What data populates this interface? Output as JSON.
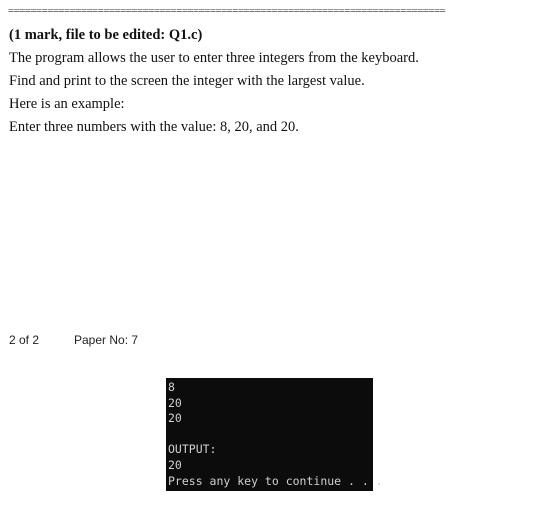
{
  "separator": "==============================================================================",
  "heading": "(1 mark, file to be edited: Q1.c)",
  "lines": [
    "The program allows the user to enter three integers from the keyboard.",
    "Find and print to the screen the integer with the largest value.",
    "Here is an example:",
    "Enter three numbers with the value: 8, 20, and 20."
  ],
  "footer": {
    "page": "2 of 2",
    "paper": "Paper No: 7"
  },
  "console": {
    "lines": [
      "8",
      "20",
      "20",
      "",
      "OUTPUT:",
      "20",
      "Press any key to continue . . ."
    ]
  }
}
